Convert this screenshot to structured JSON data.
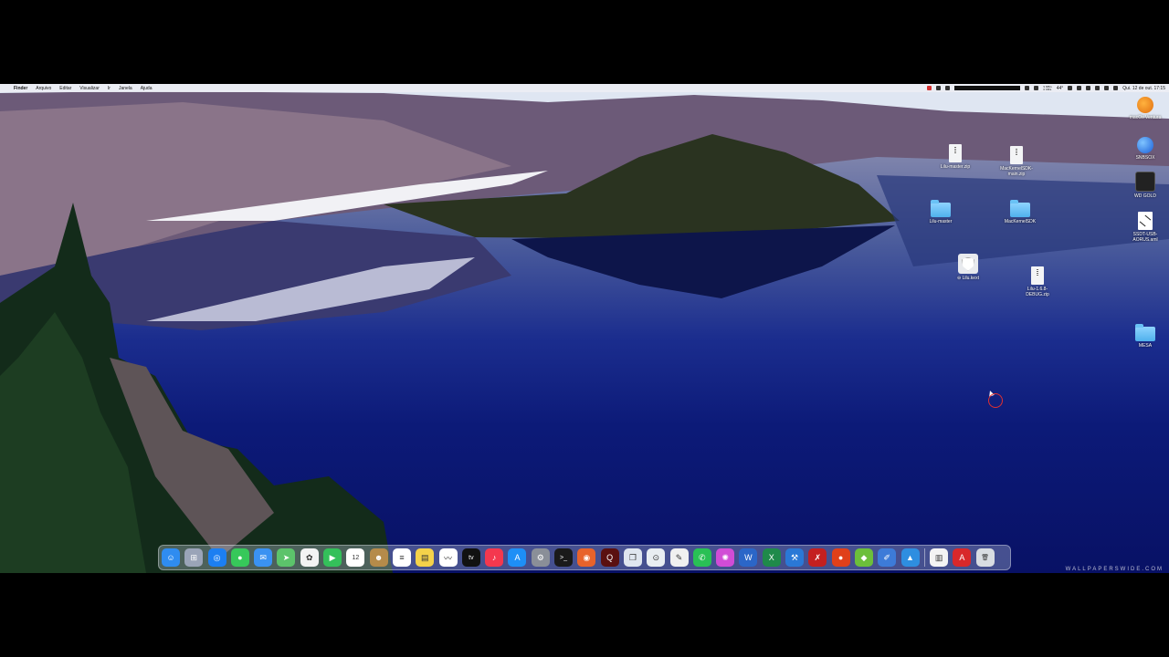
{
  "menubar": {
    "apple_symbol": "",
    "items": [
      "Finder",
      "Arquivo",
      "Editar",
      "Visualizar",
      "Ir",
      "Janela",
      "Ajuda"
    ],
    "status": {
      "mem": "9 MB/s\n0 KB/s",
      "temp": "44°",
      "datetime": "Qui. 12 de out.  17:15"
    }
  },
  "desktop_icons": [
    {
      "name": "lilu-master-zip",
      "label": "Lilu-master.zip",
      "type": "zip"
    },
    {
      "name": "mackernelsdk-zip",
      "label": "MacKernelSDK-\nmain.zip",
      "type": "zip"
    },
    {
      "name": "lilu-master-folder",
      "label": "Lilu-master",
      "type": "folder"
    },
    {
      "name": "mackernelsdk-folder",
      "label": "MacKernelSDK",
      "type": "folder"
    },
    {
      "name": "lilu-kext",
      "label": "⊖ Lilu.kext",
      "type": "kext"
    },
    {
      "name": "lilu-debug-zip",
      "label": "Lilu-1.6.8-\nDEBUG.zip",
      "type": "zip"
    },
    {
      "name": "macos-ventura-drive",
      "label": "macOs Ventura",
      "type": "apple"
    },
    {
      "name": "snbsox-drive",
      "label": "SNBSOX",
      "type": "globe"
    },
    {
      "name": "wd-gold-drive",
      "label": "WD GOLD",
      "type": "drive"
    },
    {
      "name": "ssdt-file",
      "label": "SSDT-USB-\nAORUS.aml",
      "type": "doc"
    },
    {
      "name": "mesa-folder",
      "label": "MESA",
      "type": "folder"
    }
  ],
  "dock": {
    "apps": [
      {
        "name": "finder",
        "color": "#2f8cf0",
        "glyph": "☺"
      },
      {
        "name": "launchpad",
        "color": "#9aa4b8",
        "glyph": "⊞"
      },
      {
        "name": "safari",
        "color": "#1c7ff2",
        "glyph": "◎"
      },
      {
        "name": "messages",
        "color": "#37c85a",
        "glyph": "●"
      },
      {
        "name": "mail",
        "color": "#3a92f2",
        "glyph": "✉"
      },
      {
        "name": "maps",
        "color": "#5cc36b",
        "glyph": "➤"
      },
      {
        "name": "photos",
        "color": "#f3f3f3",
        "glyph": "✿"
      },
      {
        "name": "facetime",
        "color": "#34c05a",
        "glyph": "▶"
      },
      {
        "name": "calendar",
        "color": "#ffffff",
        "glyph": "12"
      },
      {
        "name": "contacts",
        "color": "#b58b4a",
        "glyph": "☻"
      },
      {
        "name": "reminders",
        "color": "#ffffff",
        "glyph": "≡"
      },
      {
        "name": "notes",
        "color": "#f5d24a",
        "glyph": "▤"
      },
      {
        "name": "freeform",
        "color": "#ffffff",
        "glyph": "〰"
      },
      {
        "name": "apple-tv",
        "color": "#111111",
        "glyph": "tv"
      },
      {
        "name": "music",
        "color": "#f4384e",
        "glyph": "♪"
      },
      {
        "name": "app-store",
        "color": "#1e8ff6",
        "glyph": "A"
      },
      {
        "name": "system-settings",
        "color": "#8a8f98",
        "glyph": "⚙"
      },
      {
        "name": "terminal",
        "color": "#1a1a1a",
        "glyph": ">_"
      },
      {
        "name": "firefox",
        "color": "#e8632b",
        "glyph": "◉"
      },
      {
        "name": "quake",
        "color": "#5a1010",
        "glyph": "Q"
      },
      {
        "name": "preview",
        "color": "#dfe6ef",
        "glyph": "❐"
      },
      {
        "name": "opencore-configurator",
        "color": "#e9eef2",
        "glyph": "⊙"
      },
      {
        "name": "script-editor",
        "color": "#f0f0f0",
        "glyph": "✎"
      },
      {
        "name": "whatsapp",
        "color": "#29c055",
        "glyph": "✆"
      },
      {
        "name": "flower-app",
        "color": "#d14cd6",
        "glyph": "✺"
      },
      {
        "name": "word",
        "color": "#2b66c8",
        "glyph": "W"
      },
      {
        "name": "excel",
        "color": "#1f8a4a",
        "glyph": "X"
      },
      {
        "name": "xcode",
        "color": "#2a78d6",
        "glyph": "⚒"
      },
      {
        "name": "xtools",
        "color": "#c42020",
        "glyph": "✗"
      },
      {
        "name": "screen-recorder",
        "color": "#e0401a",
        "glyph": "●"
      },
      {
        "name": "cube-app",
        "color": "#6cbf3a",
        "glyph": "◆"
      },
      {
        "name": "propertree",
        "color": "#3d7bd8",
        "glyph": "✐"
      },
      {
        "name": "image-app",
        "color": "#2e8ee0",
        "glyph": "▲"
      }
    ],
    "documents": [
      {
        "name": "zip-document",
        "color": "#f4f4f4",
        "glyph": "▥"
      },
      {
        "name": "acrobat-reader",
        "color": "#d8282a",
        "glyph": "A"
      },
      {
        "name": "trash",
        "color": "#d9dde2",
        "glyph": "🗑"
      }
    ]
  },
  "watermark": "WALLPAPERSWIDE.COM"
}
